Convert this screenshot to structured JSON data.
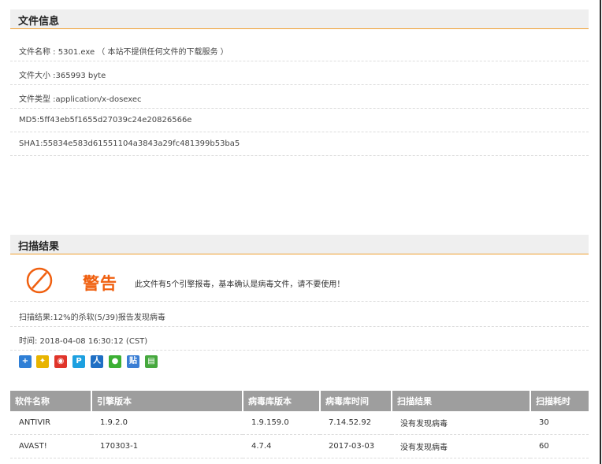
{
  "file_info": {
    "title": "文件信息",
    "rows": [
      {
        "label": "文件名称 : 5301.exe （ 本站不提供任何文件的下载服务 ）"
      },
      {
        "label": "文件大小 :365993 byte"
      },
      {
        "label": "文件类型 :application/x-dosexec"
      },
      {
        "label": "MD5:5ff43eb5f1655d27039c24e20826566e"
      },
      {
        "label": "SHA1:55834e583d61551104a3843a29fc481399b53ba5"
      }
    ]
  },
  "scan_result": {
    "title": "扫描结果",
    "warning_title": "警告",
    "warning_text": "此文件有5个引擎报毒，基本确认是病毒文件，请不要使用！",
    "summary": "扫描结果:12%的杀软(5/39)报告发现病毒",
    "time": "时间: 2018-04-08 16:30:12 (CST)",
    "share_icons": [
      {
        "name": "share-plus-icon",
        "glyph": "+",
        "color": "#2f7fd6"
      },
      {
        "name": "qzone-icon",
        "glyph": "✦",
        "color": "#e8b400"
      },
      {
        "name": "weibo-icon",
        "glyph": "◉",
        "color": "#e0342a"
      },
      {
        "name": "qq-icon",
        "glyph": "P",
        "color": "#1da0e0"
      },
      {
        "name": "renren-icon",
        "glyph": "人",
        "color": "#1f6fc4"
      },
      {
        "name": "wechat-icon",
        "glyph": "●",
        "color": "#3cb034"
      },
      {
        "name": "tieba-icon",
        "glyph": "贴",
        "color": "#3a7ed4"
      },
      {
        "name": "douban-icon",
        "glyph": "▤",
        "color": "#46a83e"
      }
    ]
  },
  "table": {
    "headers": [
      "软件名称",
      "引擎版本",
      "病毒库版本",
      "病毒库时间",
      "扫描结果",
      "扫描耗时"
    ],
    "rows": [
      [
        "ANTIVIR",
        "1.9.2.0",
        "1.9.159.0",
        "7.14.52.92",
        "没有发现病毒",
        "30"
      ],
      [
        "AVAST!",
        "170303-1",
        "4.7.4",
        "2017-03-03",
        "没有发现病毒",
        "60"
      ]
    ]
  }
}
